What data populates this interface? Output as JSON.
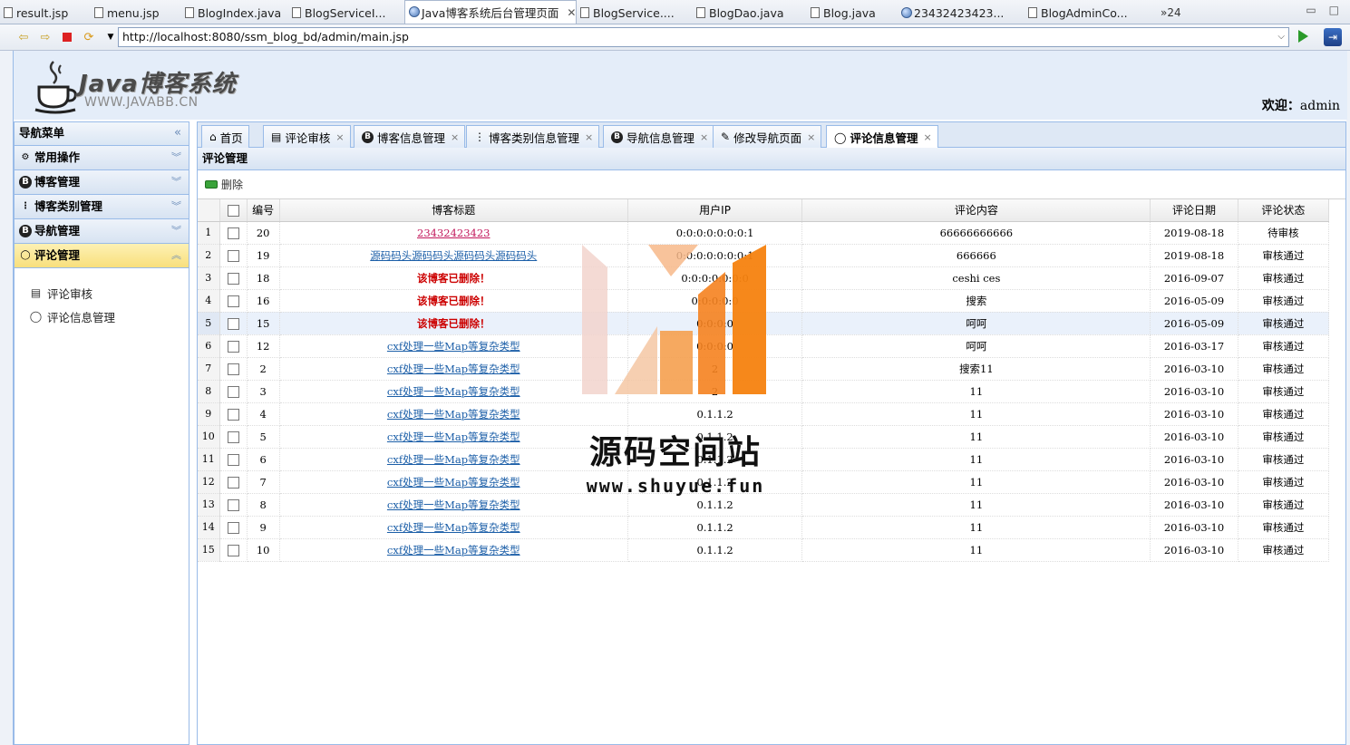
{
  "editor_tabs": [
    {
      "label": "result.jsp",
      "active": false,
      "globe": false
    },
    {
      "label": "menu.jsp",
      "active": false,
      "globe": false
    },
    {
      "label": "BlogIndex.java",
      "active": false,
      "globe": false
    },
    {
      "label": "BlogServiceI...",
      "active": false,
      "globe": false
    },
    {
      "label": "Java博客系统后台管理页面",
      "active": true,
      "globe": true
    },
    {
      "label": "BlogService....",
      "active": false,
      "globe": false
    },
    {
      "label": "BlogDao.java",
      "active": false,
      "globe": false
    },
    {
      "label": "Blog.java",
      "active": false,
      "globe": false
    },
    {
      "label": "23432423423...",
      "active": false,
      "globe": true
    },
    {
      "label": "BlogAdminCo...",
      "active": false,
      "globe": false
    }
  ],
  "editor_tabs_overflow": "»24",
  "address": {
    "url": "http://localhost:8080/ssm_blog_bd/admin/main.jsp"
  },
  "header": {
    "logo_title": "Java博客系统",
    "logo_sub": "WWW.JAVABB.CN",
    "welcome_label": "欢迎：",
    "welcome_user": "admin"
  },
  "sidebar": {
    "title": "导航菜单",
    "sections": [
      {
        "label": "常用操作",
        "icon": "gear-icon",
        "active": false
      },
      {
        "label": "博客管理",
        "icon": "blog-icon",
        "active": false
      },
      {
        "label": "博客类别管理",
        "icon": "tree-icon",
        "active": false
      },
      {
        "label": "导航管理",
        "icon": "blog-icon",
        "active": false
      },
      {
        "label": "评论管理",
        "icon": "comment-icon",
        "active": true
      }
    ],
    "items": [
      {
        "label": "评论审核",
        "icon": "review-icon"
      },
      {
        "label": "评论信息管理",
        "icon": "comment-icon"
      }
    ]
  },
  "tabs": [
    {
      "label": "首页",
      "icon": "home-icon",
      "closable": false,
      "active": false
    },
    {
      "label": "评论审核",
      "icon": "review-icon",
      "closable": true,
      "active": false
    },
    {
      "label": "博客信息管理",
      "icon": "blog-icon",
      "closable": true,
      "active": false
    },
    {
      "label": "博客类别信息管理",
      "icon": "tree-icon",
      "closable": true,
      "active": false
    },
    {
      "label": "导航信息管理",
      "icon": "blog-icon",
      "closable": true,
      "active": false
    },
    {
      "label": "修改导航页面",
      "icon": "edit-icon",
      "closable": true,
      "active": false
    },
    {
      "label": "评论信息管理",
      "icon": "comment-icon",
      "closable": true,
      "active": true
    }
  ],
  "panel": {
    "title": "评论管理",
    "delete_label": "删除"
  },
  "table": {
    "columns": [
      "编号",
      "博客标题",
      "用户IP",
      "评论内容",
      "评论日期",
      "评论状态"
    ],
    "rows": [
      {
        "n": "1",
        "id": "20",
        "title": "23432423423",
        "title_type": "pink",
        "ip": "0:0:0:0:0:0:0:1",
        "content": "66666666666",
        "date": "2019-08-18",
        "status": "待审核"
      },
      {
        "n": "2",
        "id": "19",
        "title": "源码码头源码码头源码码头源码码头",
        "title_type": "link",
        "ip": "0:0:0:0:0:0:0:1",
        "content": "666666",
        "date": "2019-08-18",
        "status": "审核通过"
      },
      {
        "n": "3",
        "id": "18",
        "title": "该博客已删除！",
        "title_type": "deleted",
        "ip": "0:0:0:0:0:0:0",
        "content": "ceshi ces",
        "date": "2016-09-07",
        "status": "审核通过"
      },
      {
        "n": "4",
        "id": "16",
        "title": "该博客已删除！",
        "title_type": "deleted",
        "ip": "0:0:0:0:0",
        "content": "搜索",
        "date": "2016-05-09",
        "status": "审核通过"
      },
      {
        "n": "5",
        "id": "15",
        "title": "该博客已删除！",
        "title_type": "deleted",
        "ip": "0:0:0:0",
        "content": "呵呵",
        "date": "2016-05-09",
        "status": "审核通过"
      },
      {
        "n": "6",
        "id": "12",
        "title": "cxf处理一些Map等复杂类型",
        "title_type": "link",
        "ip": "0:0:0:0",
        "content": "呵呵",
        "date": "2016-03-17",
        "status": "审核通过"
      },
      {
        "n": "7",
        "id": "2",
        "title": "cxf处理一些Map等复杂类型",
        "title_type": "link",
        "ip": "2",
        "content": "搜索11",
        "date": "2016-03-10",
        "status": "审核通过"
      },
      {
        "n": "8",
        "id": "3",
        "title": "cxf处理一些Map等复杂类型",
        "title_type": "link",
        "ip": "2",
        "content": "11",
        "date": "2016-03-10",
        "status": "审核通过"
      },
      {
        "n": "9",
        "id": "4",
        "title": "cxf处理一些Map等复杂类型",
        "title_type": "link",
        "ip": "0.1.1.2",
        "content": "11",
        "date": "2016-03-10",
        "status": "审核通过"
      },
      {
        "n": "10",
        "id": "5",
        "title": "cxf处理一些Map等复杂类型",
        "title_type": "link",
        "ip": "0.1.1.2",
        "content": "11",
        "date": "2016-03-10",
        "status": "审核通过"
      },
      {
        "n": "11",
        "id": "6",
        "title": "cxf处理一些Map等复杂类型",
        "title_type": "link",
        "ip": "0.1.1.2",
        "content": "11",
        "date": "2016-03-10",
        "status": "审核通过"
      },
      {
        "n": "12",
        "id": "7",
        "title": "cxf处理一些Map等复杂类型",
        "title_type": "link",
        "ip": "0.1.1.2",
        "content": "11",
        "date": "2016-03-10",
        "status": "审核通过"
      },
      {
        "n": "13",
        "id": "8",
        "title": "cxf处理一些Map等复杂类型",
        "title_type": "link",
        "ip": "0.1.1.2",
        "content": "11",
        "date": "2016-03-10",
        "status": "审核通过"
      },
      {
        "n": "14",
        "id": "9",
        "title": "cxf处理一些Map等复杂类型",
        "title_type": "link",
        "ip": "0.1.1.2",
        "content": "11",
        "date": "2016-03-10",
        "status": "审核通过"
      },
      {
        "n": "15",
        "id": "10",
        "title": "cxf处理一些Map等复杂类型",
        "title_type": "link",
        "ip": "0.1.1.2",
        "content": "11",
        "date": "2016-03-10",
        "status": "审核通过"
      }
    ],
    "highlight_row": "5"
  },
  "watermark": {
    "text": "源码空间站",
    "url": "www.shuyue.fun"
  },
  "colors": {
    "accent": "#99bbe8",
    "active_section": "#f8df7c",
    "link": "#1c5fa8",
    "deleted": "#cc0000",
    "watermark_orange": "#f5821f"
  }
}
